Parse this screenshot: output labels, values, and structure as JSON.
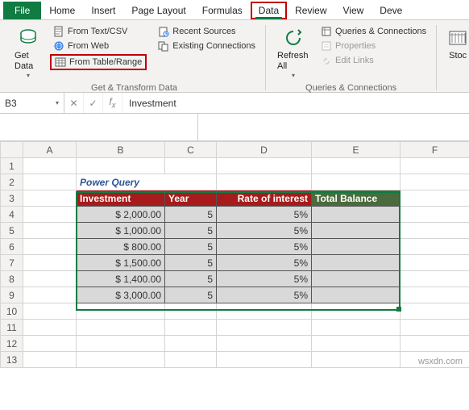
{
  "menu": {
    "file": "File",
    "home": "Home",
    "insert": "Insert",
    "page_layout": "Page Layout",
    "formulas": "Formulas",
    "data": "Data",
    "review": "Review",
    "view": "View",
    "developer": "Deve"
  },
  "ribbon": {
    "get_transform": {
      "get_data": "Get Data",
      "from_text_csv": "From Text/CSV",
      "from_web": "From Web",
      "from_table_range": "From Table/Range",
      "recent_sources": "Recent Sources",
      "existing_connections": "Existing Connections",
      "group_label": "Get & Transform Data"
    },
    "queries_conn": {
      "refresh_all": "Refresh All",
      "queries_connections": "Queries & Connections",
      "properties": "Properties",
      "edit_links": "Edit Links",
      "group_label": "Queries & Connections"
    },
    "stocks_label": "Stoc"
  },
  "namebox": "B3",
  "formula_value": "Investment",
  "sheet": {
    "columns": [
      "A",
      "B",
      "C",
      "D",
      "E",
      "F"
    ],
    "title": "Power Query",
    "headers": {
      "investment": "Investment",
      "year": "Year",
      "rate": "Rate of interest",
      "total": "Total Balance"
    },
    "rows": [
      {
        "inv": "$      2,000.00",
        "year": "5",
        "rate": "5%",
        "total": ""
      },
      {
        "inv": "$      1,000.00",
        "year": "5",
        "rate": "5%",
        "total": ""
      },
      {
        "inv": "$         800.00",
        "year": "5",
        "rate": "5%",
        "total": ""
      },
      {
        "inv": "$      1,500.00",
        "year": "5",
        "rate": "5%",
        "total": ""
      },
      {
        "inv": "$      1,400.00",
        "year": "5",
        "rate": "5%",
        "total": ""
      },
      {
        "inv": "$      3,000.00",
        "year": "5",
        "rate": "5%",
        "total": ""
      }
    ]
  },
  "watermark": "wsxdn.com"
}
